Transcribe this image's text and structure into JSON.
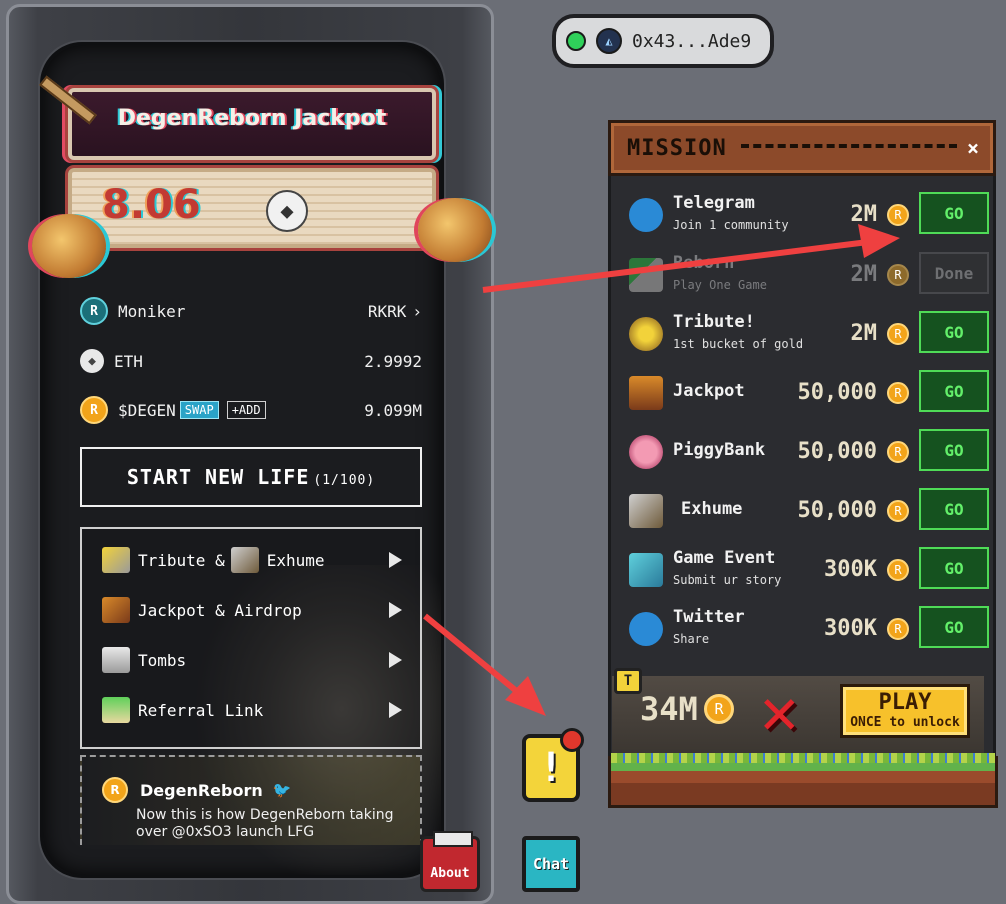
{
  "wallet": {
    "address": "0x43...Ade9",
    "status_color": "#2fd05a"
  },
  "jackpot": {
    "title": "DegenReborn Jackpot",
    "value": "8.06",
    "currency_icon": "eth-icon"
  },
  "account": {
    "moniker_label": "Moniker",
    "moniker_value": "RKRK",
    "eth_label": "ETH",
    "eth_value": "2.9992",
    "degen_label": "$DEGEN",
    "swap_label": "SWAP",
    "add_label": "+ADD",
    "degen_value": "9.099M"
  },
  "start": {
    "label": "START NEW LIFE",
    "count": "(1/100)"
  },
  "menu": [
    {
      "label": "Tribute & ",
      "label2": "Exhume"
    },
    {
      "label": "Jackpot & Airdrop"
    },
    {
      "label": "Tombs"
    },
    {
      "label": "Referral Link"
    }
  ],
  "tweet": {
    "author": "DegenReborn",
    "text": "Now this is how DegenReborn taking over @0xSO3 launch LFG"
  },
  "about_label": "About",
  "chat_label": "Chat",
  "alert_symbol": "!",
  "mission": {
    "title": "MISSION",
    "close": "×",
    "tasks": [
      {
        "title": "Telegram",
        "sub": "Join 1 community",
        "reward": "2M",
        "button": "GO"
      },
      {
        "title": "Reborn",
        "sub": "Play One Game",
        "reward": "2M",
        "button": "Done"
      },
      {
        "title": "Tribute!",
        "sub": "1st bucket of gold",
        "reward": "2M",
        "button": "GO"
      },
      {
        "title": "Jackpot",
        "sub": "",
        "reward": "50,000",
        "button": "GO"
      },
      {
        "title": "PiggyBank",
        "sub": "",
        "reward": "50,000",
        "button": "GO"
      },
      {
        "title": "Exhume",
        "sub": "",
        "reward": "50,000",
        "button": "GO"
      },
      {
        "title": "Game Event",
        "sub": "Submit ur story",
        "reward": "300K",
        "button": "GO"
      },
      {
        "title": "Twitter",
        "sub": "Share",
        "reward": "300K",
        "button": "GO"
      }
    ],
    "total_reward": "34M",
    "play_label": "PLAY",
    "play_sub": "ONCE to unlock",
    "lock_symbol": "T"
  },
  "colors": {
    "go_green": "#4fdb57",
    "arrow_red": "#ef4040",
    "coin": "#f2a41a"
  }
}
